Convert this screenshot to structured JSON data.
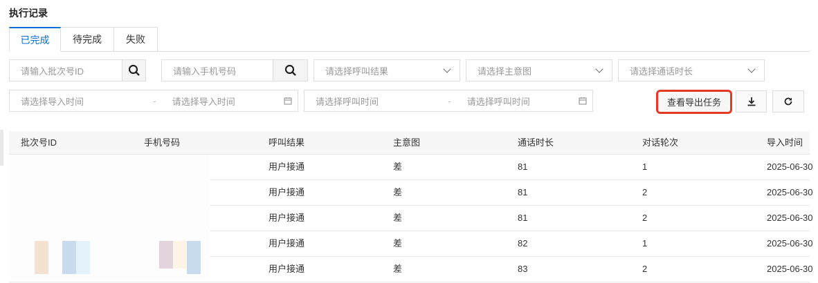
{
  "page_title": "执行记录",
  "tabs": [
    {
      "label": "已完成"
    },
    {
      "label": "待完成"
    },
    {
      "label": "失败"
    }
  ],
  "filters": {
    "batch_id_placeholder": "请输入批次号ID",
    "phone_placeholder": "请输入手机号码",
    "call_result_placeholder": "请选择呼叫结果",
    "intent_placeholder": "请选择主意图",
    "duration_placeholder": "请选择通话时长",
    "import_start_placeholder": "请选择导入时间",
    "import_end_placeholder": "请选择导入时间",
    "call_start_placeholder": "请选择呼叫时间",
    "call_end_placeholder": "请选择呼叫时间",
    "range_sep": "-"
  },
  "actions": {
    "view_export_tasks": "查看导出任务"
  },
  "table": {
    "columns": [
      "批次号ID",
      "手机号码",
      "呼叫结果",
      "主意图",
      "通话时长",
      "对话轮次",
      "导入时间"
    ],
    "rows": [
      [
        "",
        "",
        "用户接通",
        "差",
        "81",
        "1",
        "2025-06-30"
      ],
      [
        "",
        "",
        "用户接通",
        "差",
        "81",
        "2",
        "2025-06-30"
      ],
      [
        "",
        "",
        "用户接通",
        "差",
        "81",
        "2",
        "2025-06-30"
      ],
      [
        "",
        "",
        "用户接通",
        "差",
        "82",
        "1",
        "2025-06-30"
      ],
      [
        "",
        "",
        "用户接通",
        "差",
        "83",
        "2",
        "2025-06-30"
      ]
    ]
  },
  "colors": {
    "accent": "#0a6fd0",
    "highlight": "#e43a25"
  }
}
